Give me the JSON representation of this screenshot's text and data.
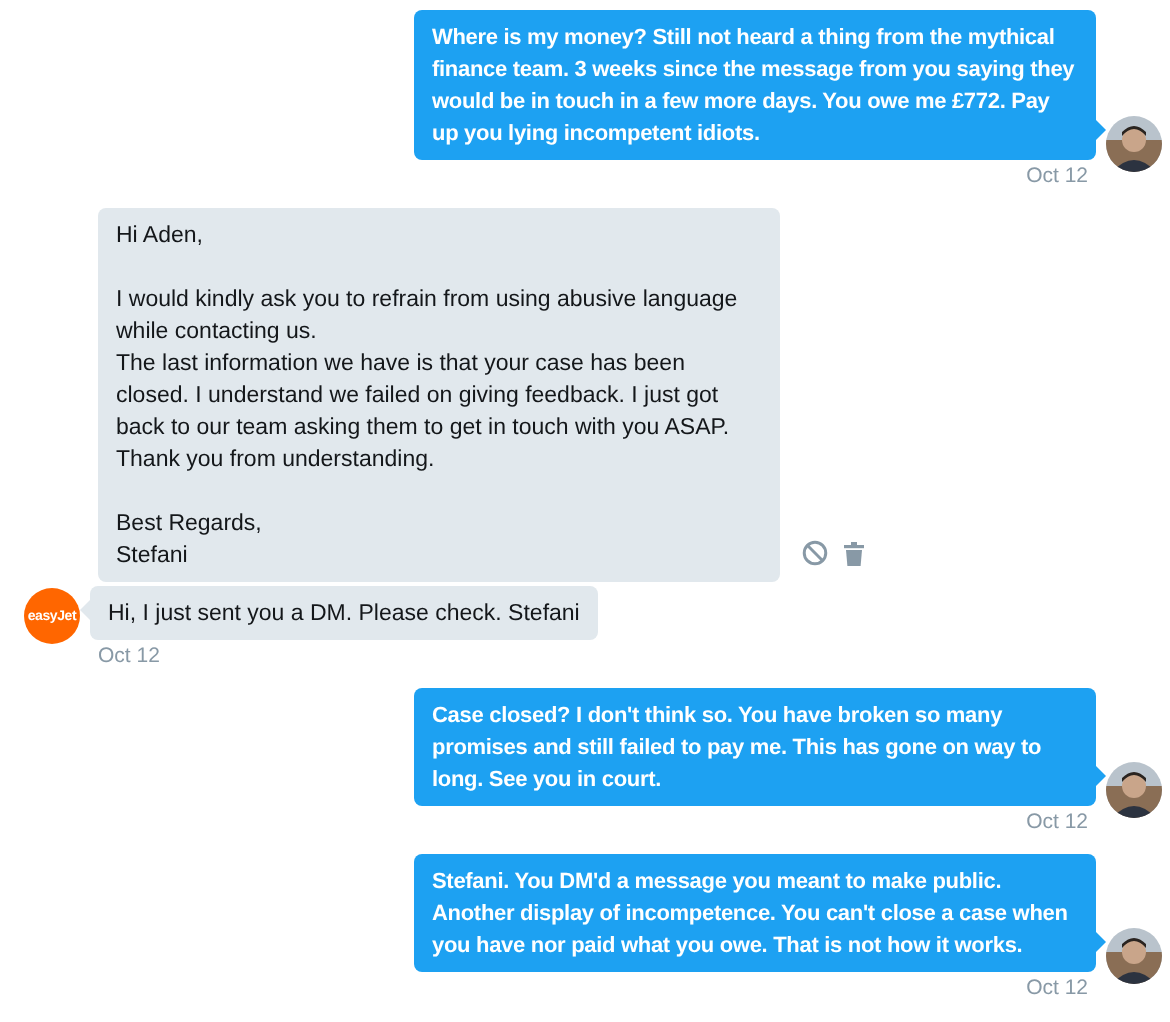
{
  "messages": [
    {
      "kind": "sent",
      "text": "Where is my money? Still not heard a thing from the mythical finance team. 3 weeks since the message from you saying they would be in touch in a few more days. You owe me £772. Pay up you lying incompetent idiots.",
      "avatar": true,
      "time": "Oct 12"
    },
    {
      "kind": "received",
      "text": "Hi Aden,\n\nI would kindly ask you to refrain from using abusive language while contacting us.\nThe last information we have is that your case has been closed. I understand we failed on giving feedback. I just got back to our team asking them to get in touch with you ASAP.\nThank you from understanding.\n\nBest Regards,\nStefani",
      "avatar": false,
      "actions": true
    },
    {
      "kind": "received",
      "text": "Hi, I just sent you a DM. Please check. Stefani",
      "avatar": true,
      "logo_text": "easyJet",
      "time": "Oct 12"
    },
    {
      "kind": "sent",
      "text": "Case closed? I don't think so. You have broken so many promises and still failed to pay me. This has gone on way to long. See you in court.",
      "avatar": true,
      "time": "Oct 12"
    },
    {
      "kind": "sent",
      "text": "Stefani. You DM'd a message you meant to make public. Another display of incompetence. You can't close a case when you have nor paid what you owe. That is not how it works.",
      "avatar": true,
      "time": "Oct 12"
    }
  ]
}
